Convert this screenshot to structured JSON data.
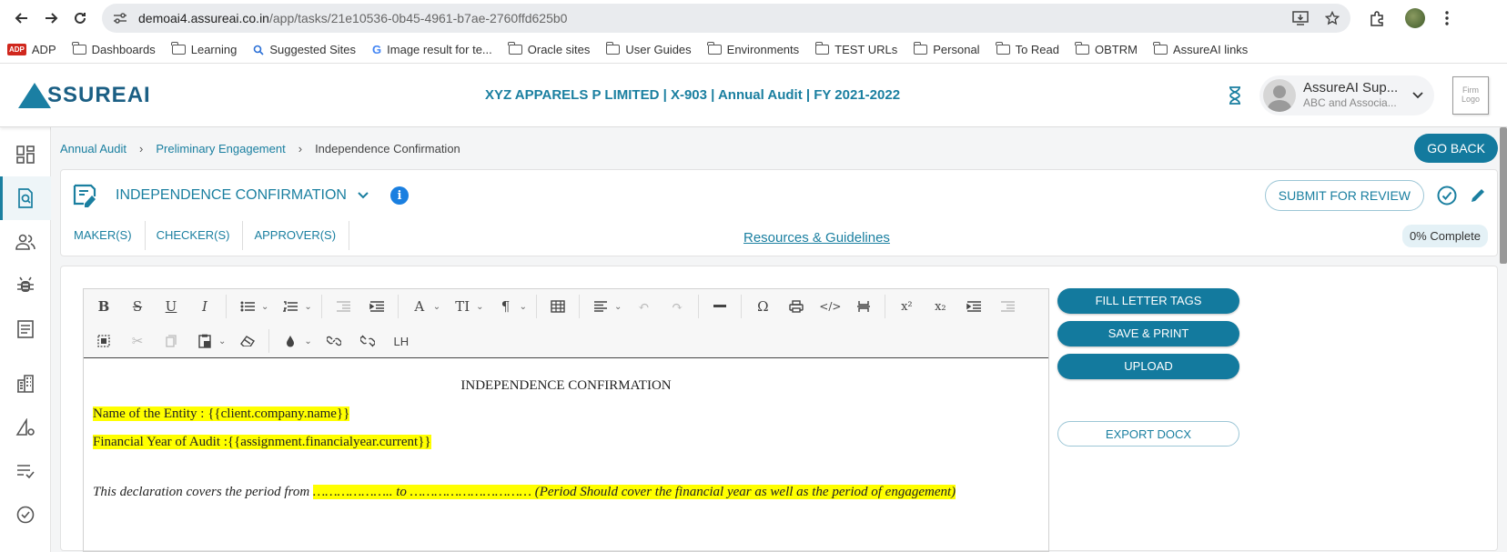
{
  "browser": {
    "url_host": "demoai4.assureai.co.in",
    "url_path": "/app/tasks/21e10536-0b45-4961-b7ae-2760ffd625b0",
    "bookmarks": [
      "ADP",
      "Dashboards",
      "Learning",
      "Suggested Sites",
      "Image result for te...",
      "Oracle sites",
      "User Guides",
      "Environments",
      "TEST URLs",
      "Personal",
      "To Read",
      "OBTRM",
      "AssureAI links"
    ]
  },
  "header": {
    "logo_text": "SSUREAI",
    "title": "XYZ APPARELS P LIMITED | X-903 | Annual Audit | FY 2021-2022",
    "user_name": "AssureAI Sup...",
    "user_org": "ABC and Associa...",
    "firm_logo": "Firm Logo"
  },
  "breadcrumb": {
    "items": [
      "Annual Audit",
      "Preliminary Engagement"
    ],
    "current": "Independence Confirmation",
    "go_back": "GO BACK"
  },
  "task": {
    "title": "INDEPENDENCE CONFIRMATION",
    "submit": "SUBMIT FOR REVIEW",
    "tabs": [
      "MAKER(S)",
      "CHECKER(S)",
      "APPROVER(S)"
    ],
    "resources": "Resources & Guidelines",
    "progress": "0% Complete",
    "progress_value": 0
  },
  "editor": {
    "lh_label": "LH",
    "doc_title": "INDEPENDENCE CONFIRMATION",
    "entity_line": "Name of the Entity : {{client.company.name}}",
    "fy_line": "Financial Year of Audit :{{assignment.financialyear.current}}",
    "decl_prefix": "This declaration covers the period from ",
    "decl_highlight": "……………….. to ………………………… (Period Should cover the financial year as well as the period of engagement)"
  },
  "actions": {
    "fill": "FILL LETTER TAGS",
    "save": "SAVE & PRINT",
    "upload": "UPLOAD",
    "export": "EXPORT DOCX"
  }
}
